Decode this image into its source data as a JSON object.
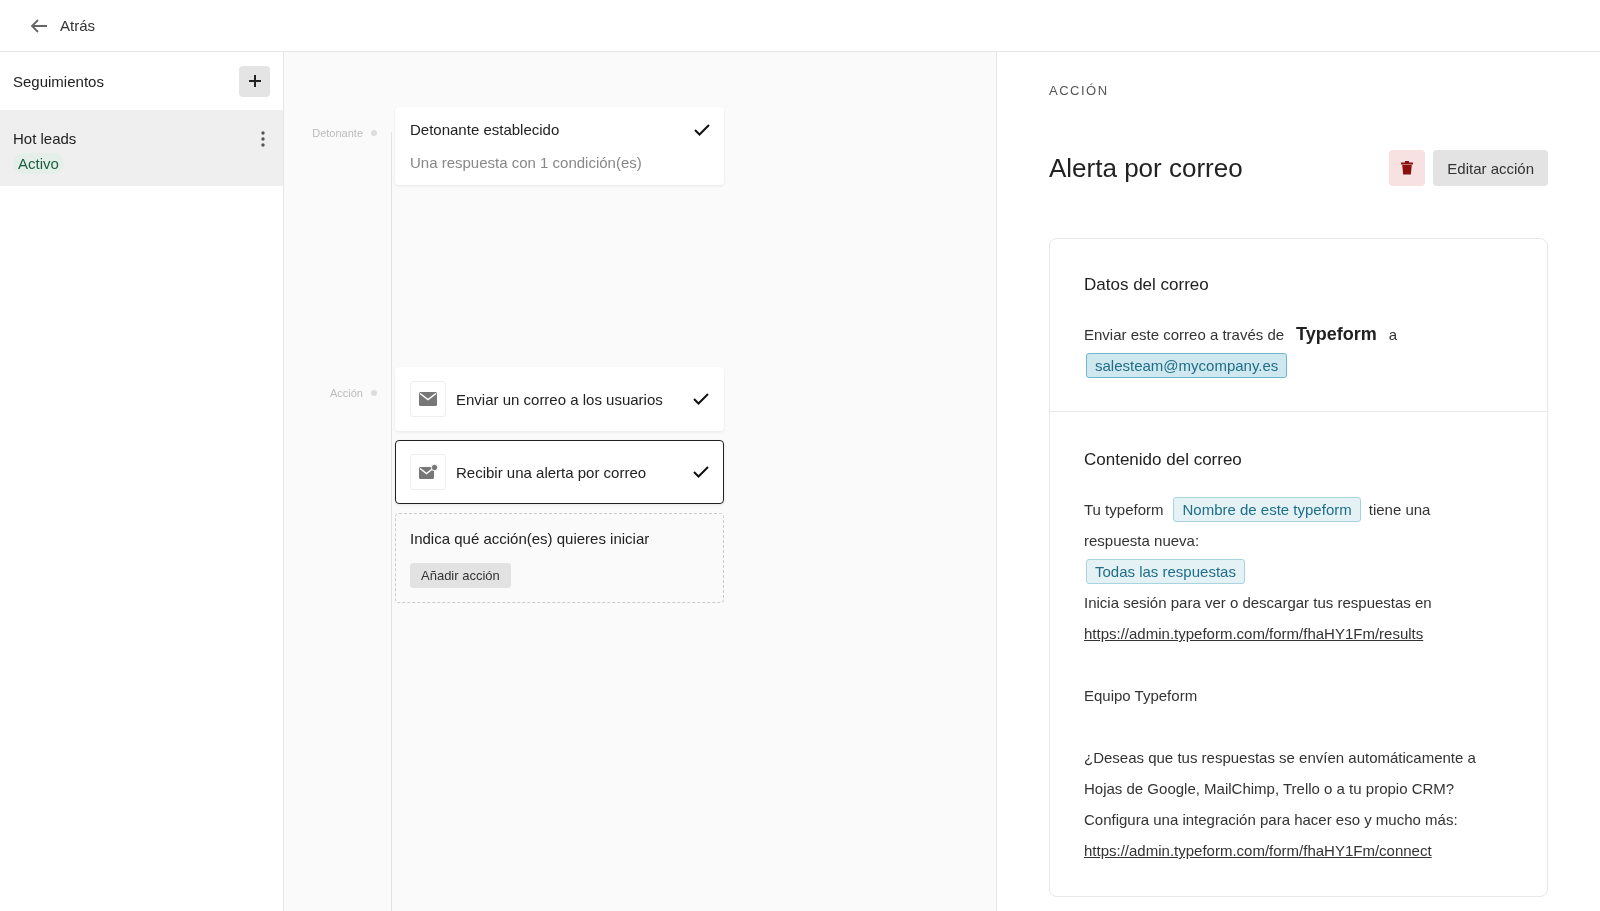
{
  "header": {
    "back_label": "Atrás"
  },
  "sidebar": {
    "title": "Seguimientos",
    "items": [
      {
        "name": "Hot leads",
        "status": "Activo",
        "selected": true
      }
    ]
  },
  "flow": {
    "trigger": {
      "label": "Detonante",
      "title": "Detonante establecido",
      "subtitle": "Una respuesta con 1 condición(es)",
      "checked": true
    },
    "action": {
      "label": "Acción",
      "items": [
        {
          "kind": "mail",
          "title": "Enviar un correo a los usuarios",
          "checked": true,
          "selected": false
        },
        {
          "kind": "mail-alert",
          "title": "Recibir una alerta por correo",
          "checked": true,
          "selected": true
        }
      ],
      "add": {
        "prompt": "Indica qué acción(es) quieres iniciar",
        "button": "Añadir acción"
      }
    }
  },
  "detail": {
    "eyebrow": "ACCIÓN",
    "title": "Alerta por correo",
    "edit_button": "Editar acción",
    "sections": [
      {
        "title": "Datos del correo",
        "paragraphs": [
          {
            "lines": [
              [
                {
                  "kind": "text",
                  "text": "Enviar este correo a través de"
                },
                {
                  "kind": "strong",
                  "text": "Typeform"
                },
                {
                  "kind": "text",
                  "text": "a"
                }
              ],
              [
                {
                  "kind": "tag",
                  "text": "salesteam@mycompany.es"
                }
              ]
            ]
          }
        ]
      },
      {
        "title": "Contenido del correo",
        "paragraphs": [
          {
            "lines": [
              [
                {
                  "kind": "text",
                  "text": "Tu typeform"
                },
                {
                  "kind": "tag",
                  "text": "Nombre de este typeform"
                },
                {
                  "kind": "text",
                  "text": "tiene una"
                }
              ],
              [
                {
                  "kind": "text",
                  "text": "respuesta nueva:"
                }
              ],
              [
                {
                  "kind": "tag",
                  "text": "Todas las respuestas"
                }
              ],
              [
                {
                  "kind": "text",
                  "text": "Inicia sesión para ver o descargar tus respuestas en"
                }
              ],
              [
                {
                  "kind": "link",
                  "text": "https://admin.typeform.com/form/fhaHY1Fm/results"
                }
              ]
            ]
          },
          {
            "lines": [
              [
                {
                  "kind": "text",
                  "text": "Equipo Typeform"
                }
              ]
            ]
          },
          {
            "lines": [
              [
                {
                  "kind": "text",
                  "text": "¿Deseas que tus respuestas se envíen automáticamente a"
                }
              ],
              [
                {
                  "kind": "text",
                  "text": "Hojas de Google, MailChimp, Trello o a tu propio CRM?"
                }
              ],
              [
                {
                  "kind": "text",
                  "text": "Configura una integración para hacer eso y mucho más:"
                }
              ],
              [
                {
                  "kind": "link",
                  "text": "https://admin.typeform.com/form/fhaHY1Fm/connect"
                }
              ]
            ]
          }
        ]
      }
    ]
  }
}
